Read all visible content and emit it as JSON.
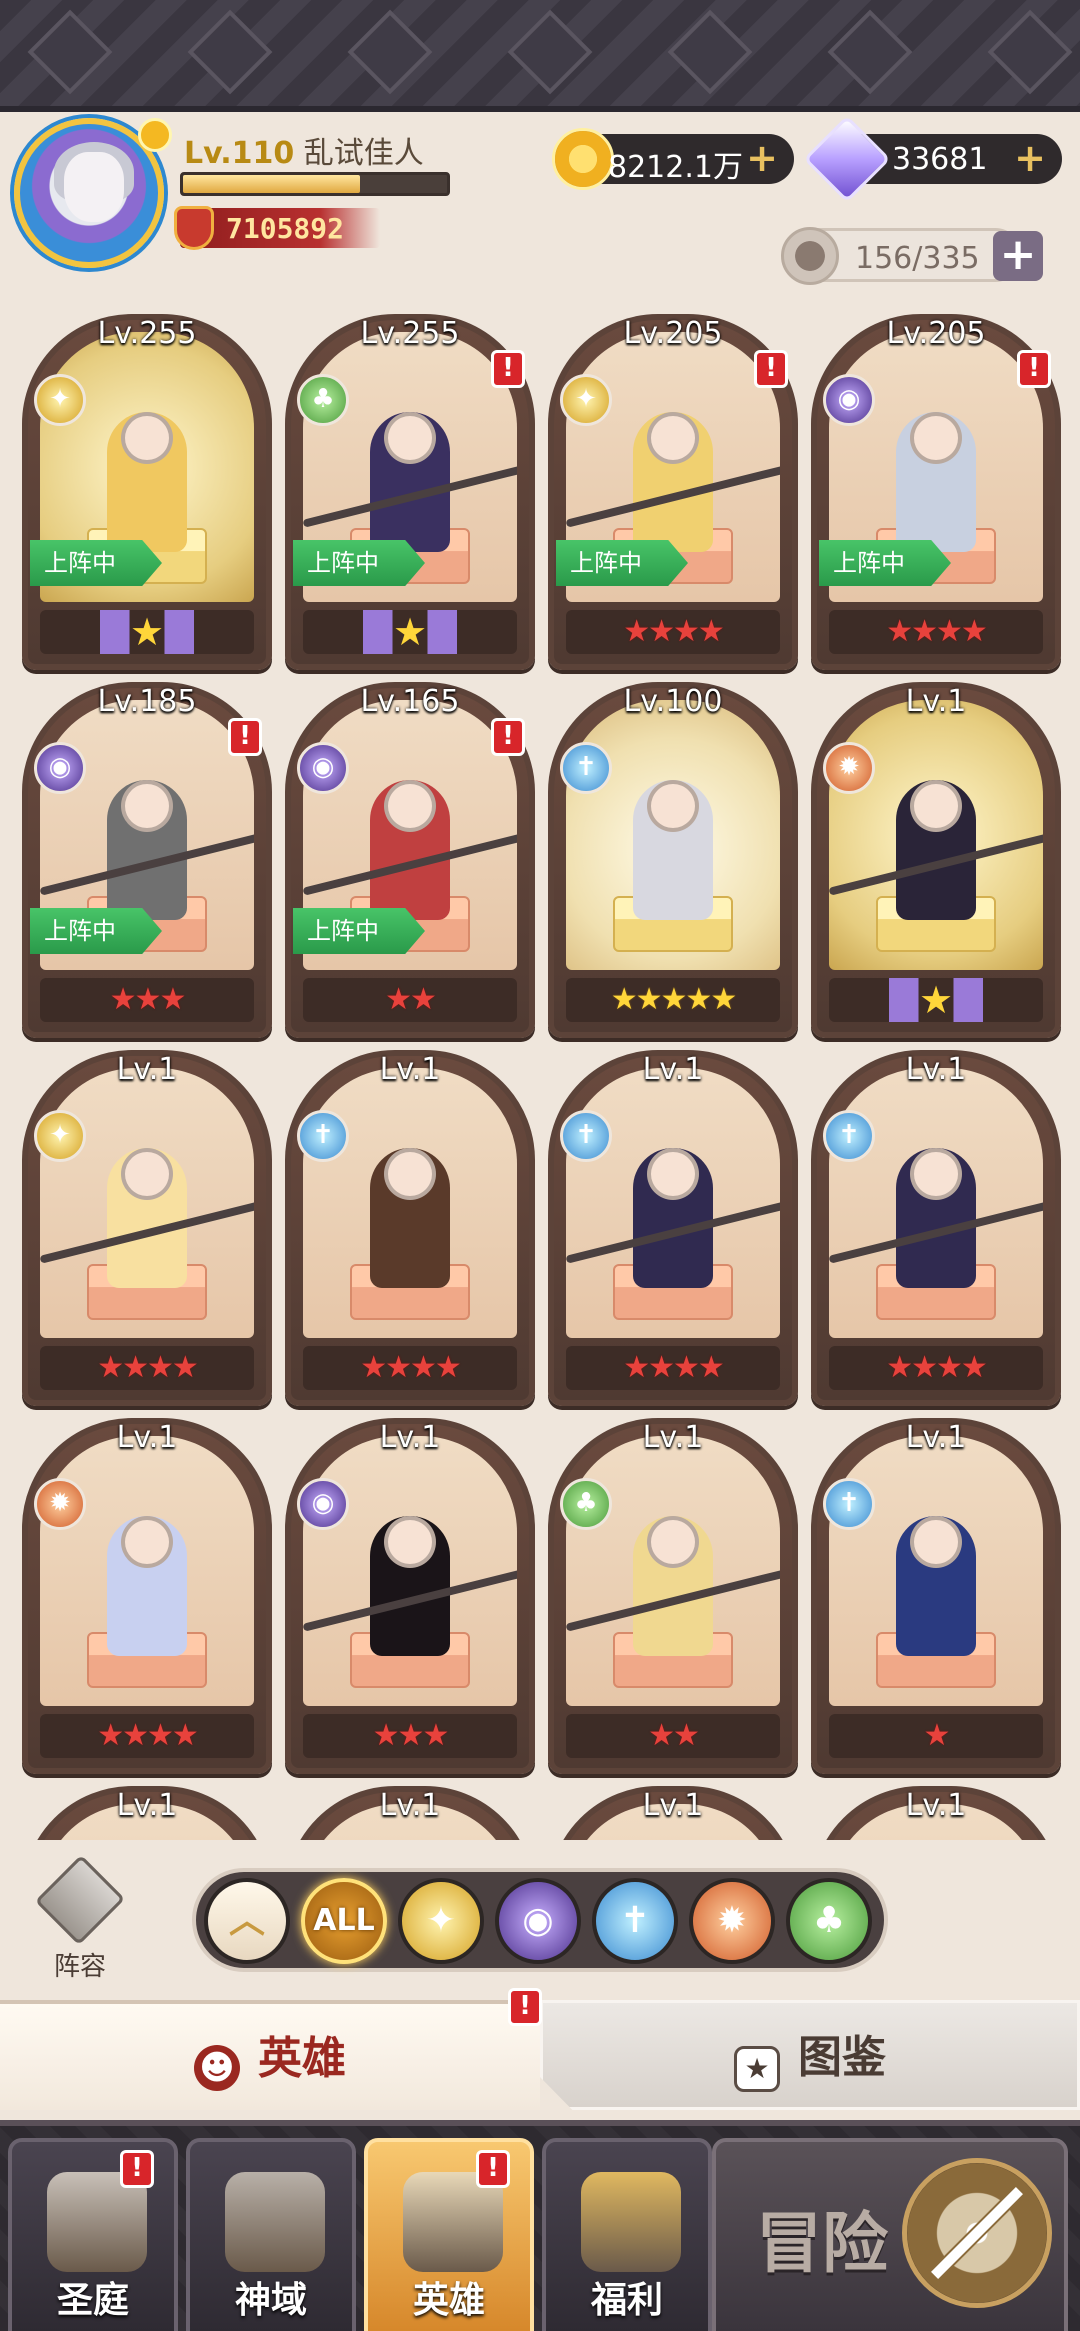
{
  "player": {
    "level": "Lv.110",
    "name": "乱试佳人",
    "xp_fraction": 0.67,
    "power": "7105892"
  },
  "resources": {
    "gold": "8212.1万",
    "gems": "33681",
    "hero_capacity": "156/335"
  },
  "colors": {
    "star_red": "#e8423c",
    "star_gold": "#ffd63a",
    "alert": "#d8252a",
    "deployed_green": "#2a9a4a",
    "active_tab_text": "#9a2820"
  },
  "heroes": [
    {
      "level": "Lv.255",
      "faction": "light",
      "alert": false,
      "deployed": "上阵中",
      "stars": 1,
      "star_style": "gold-wing",
      "frame": "gold"
    },
    {
      "level": "Lv.255",
      "faction": "nature",
      "alert": true,
      "deployed": "上阵中",
      "stars": 1,
      "star_style": "gold-wing",
      "frame": "normal"
    },
    {
      "level": "Lv.205",
      "faction": "light",
      "alert": true,
      "deployed": "上阵中",
      "stars": 4,
      "star_style": "red",
      "frame": "normal"
    },
    {
      "level": "Lv.205",
      "faction": "dark",
      "alert": true,
      "deployed": "上阵中",
      "stars": 4,
      "star_style": "red",
      "frame": "normal"
    },
    {
      "level": "Lv.185",
      "faction": "dark",
      "alert": true,
      "deployed": "上阵中",
      "stars": 3,
      "star_style": "red",
      "frame": "normal"
    },
    {
      "level": "Lv.165",
      "faction": "dark",
      "alert": true,
      "deployed": "上阵中",
      "stars": 2,
      "star_style": "red",
      "frame": "normal"
    },
    {
      "level": "Lv.100",
      "faction": "water",
      "alert": false,
      "deployed": "",
      "stars": 5,
      "star_style": "gold",
      "frame": "glow"
    },
    {
      "level": "Lv.1",
      "faction": "fire",
      "alert": false,
      "deployed": "",
      "stars": 1,
      "star_style": "gold-wing",
      "frame": "gold"
    },
    {
      "level": "Lv.1",
      "faction": "light",
      "alert": false,
      "deployed": "",
      "stars": 4,
      "star_style": "red",
      "frame": "normal"
    },
    {
      "level": "Lv.1",
      "faction": "water",
      "alert": false,
      "deployed": "",
      "stars": 4,
      "star_style": "red",
      "frame": "normal"
    },
    {
      "level": "Lv.1",
      "faction": "water",
      "alert": false,
      "deployed": "",
      "stars": 4,
      "star_style": "red",
      "frame": "normal"
    },
    {
      "level": "Lv.1",
      "faction": "water",
      "alert": false,
      "deployed": "",
      "stars": 4,
      "star_style": "red",
      "frame": "normal"
    },
    {
      "level": "Lv.1",
      "faction": "fire",
      "alert": false,
      "deployed": "",
      "stars": 4,
      "star_style": "red",
      "frame": "normal"
    },
    {
      "level": "Lv.1",
      "faction": "dark",
      "alert": false,
      "deployed": "",
      "stars": 3,
      "star_style": "red",
      "frame": "normal"
    },
    {
      "level": "Lv.1",
      "faction": "nature",
      "alert": false,
      "deployed": "",
      "stars": 2,
      "star_style": "red",
      "frame": "normal"
    },
    {
      "level": "Lv.1",
      "faction": "water",
      "alert": false,
      "deployed": "",
      "stars": 1,
      "star_style": "red",
      "frame": "normal"
    },
    {
      "level": "Lv.1",
      "faction": "",
      "alert": false,
      "deployed": "",
      "stars": 0,
      "star_style": "red",
      "frame": "normal"
    },
    {
      "level": "Lv.1",
      "faction": "",
      "alert": false,
      "deployed": "",
      "stars": 0,
      "star_style": "red",
      "frame": "normal"
    },
    {
      "level": "Lv.1",
      "faction": "",
      "alert": false,
      "deployed": "",
      "stars": 0,
      "star_style": "red",
      "frame": "normal"
    },
    {
      "level": "Lv.1",
      "faction": "",
      "alert": false,
      "deployed": "",
      "stars": 0,
      "star_style": "red",
      "frame": "normal"
    }
  ],
  "lineup_label": "阵容",
  "filters": [
    {
      "id": "up",
      "label": "",
      "icon": "chevron-up-icon"
    },
    {
      "id": "all",
      "label": "ALL",
      "icon": ""
    },
    {
      "id": "light",
      "label": "",
      "icon": "light-faction-icon"
    },
    {
      "id": "dark",
      "label": "",
      "icon": "dark-faction-icon"
    },
    {
      "id": "water",
      "label": "",
      "icon": "water-faction-icon"
    },
    {
      "id": "fire",
      "label": "",
      "icon": "fire-faction-icon"
    },
    {
      "id": "nature",
      "label": "",
      "icon": "nature-faction-icon"
    }
  ],
  "tabs": {
    "heroes": "英雄",
    "codex": "图鉴"
  },
  "nav": [
    {
      "label": "圣庭",
      "icon": "sanctuary-icon",
      "alert": true,
      "active": false
    },
    {
      "label": "神域",
      "icon": "divine-realm-icon",
      "alert": false,
      "active": false
    },
    {
      "label": "英雄",
      "icon": "hero-helmet-icon",
      "alert": true,
      "active": true
    },
    {
      "label": "福利",
      "icon": "treasure-chest-icon",
      "alert": false,
      "active": false
    }
  ],
  "adventure_label": "冒险"
}
